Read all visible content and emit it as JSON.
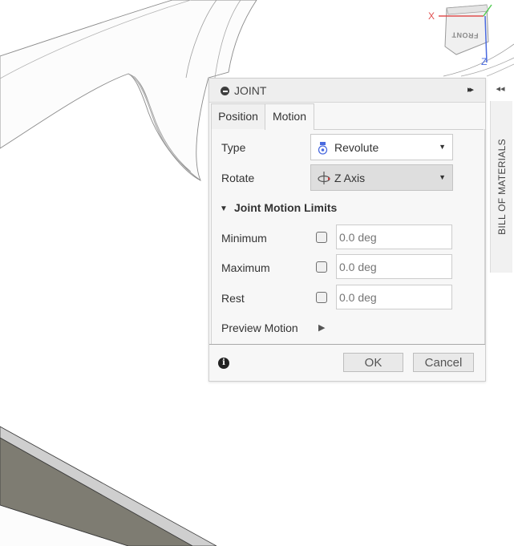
{
  "viewcube": {
    "face_front": "FRONT",
    "axis_x": "X",
    "axis_z": "Z"
  },
  "browser_panel": {
    "collapse_glyph": "◂◂",
    "bom_label": "BILL OF MATERIALS"
  },
  "dialog": {
    "title": "JOINT",
    "expand_glyph": "▸▸",
    "tabs": [
      {
        "label": "Position",
        "selected": false
      },
      {
        "label": "Motion",
        "selected": true
      }
    ],
    "type": {
      "label": "Type",
      "value": "Revolute",
      "icon": "revolute-joint-icon"
    },
    "rotate": {
      "label": "Rotate",
      "value": "Z Axis",
      "icon": "z-axis-icon"
    },
    "limits_section": {
      "label": "Joint Motion Limits",
      "expanded": true
    },
    "minimum": {
      "label": "Minimum",
      "checked": false,
      "placeholder": "0.0 deg"
    },
    "maximum": {
      "label": "Maximum",
      "checked": false,
      "placeholder": "0.0 deg"
    },
    "rest": {
      "label": "Rest",
      "checked": false,
      "placeholder": "0.0 deg"
    },
    "preview": {
      "label": "Preview Motion",
      "icon": "play-icon"
    },
    "ok_label": "OK",
    "cancel_label": "Cancel",
    "info_icon": "info-icon"
  },
  "colors": {
    "dialog_bg": "#f7f7f7",
    "axis_x": "#e05050",
    "axis_z": "#4a6adf",
    "axis_y": "#55cc55",
    "model_face": "#7e7c72"
  }
}
